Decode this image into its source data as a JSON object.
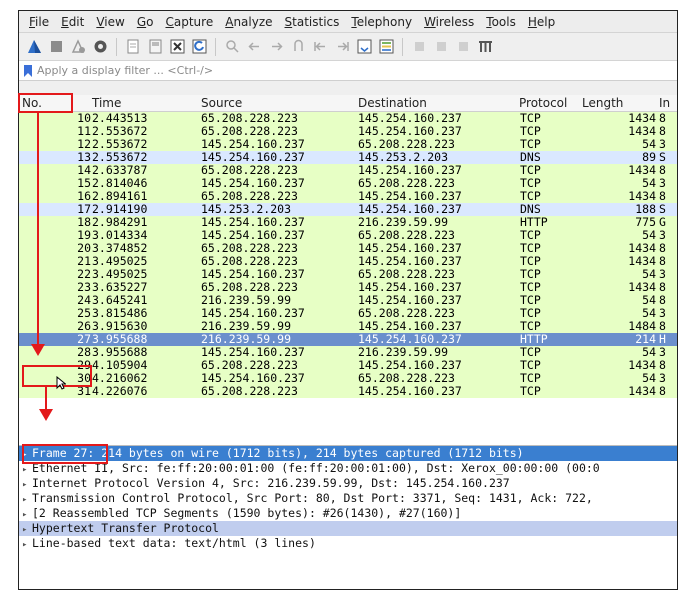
{
  "menu": [
    "File",
    "Edit",
    "View",
    "Go",
    "Capture",
    "Analyze",
    "Statistics",
    "Telephony",
    "Wireless",
    "Tools",
    "Help"
  ],
  "filter": {
    "placeholder": "Apply a display filter ... <Ctrl-/>"
  },
  "columns": {
    "no": "No.",
    "time": "Time",
    "source": "Source",
    "destination": "Destination",
    "protocol": "Protocol",
    "length": "Length",
    "info": "In"
  },
  "colors": {
    "tcp_row": "#e7ffc5",
    "dns_row": "#dae8ff",
    "http_row": "#e4ffc7",
    "selected_row": "#6b8fcc",
    "selected_detail": "#3a7fd0",
    "highlight_detail": "#c0cdee",
    "annotation_red": "#e3191b"
  },
  "packets": [
    {
      "no": "10",
      "time": "2.443513",
      "src": "65.208.228.223",
      "dst": "145.254.160.237",
      "proto": "TCP",
      "len": "1434",
      "info": "8",
      "kind": "tcp"
    },
    {
      "no": "11",
      "time": "2.553672",
      "src": "65.208.228.223",
      "dst": "145.254.160.237",
      "proto": "TCP",
      "len": "1434",
      "info": "8",
      "kind": "tcp"
    },
    {
      "no": "12",
      "time": "2.553672",
      "src": "145.254.160.237",
      "dst": "65.208.228.223",
      "proto": "TCP",
      "len": "54",
      "info": "3",
      "kind": "tcp"
    },
    {
      "no": "13",
      "time": "2.553672",
      "src": "145.254.160.237",
      "dst": "145.253.2.203",
      "proto": "DNS",
      "len": "89",
      "info": "S",
      "kind": "dns"
    },
    {
      "no": "14",
      "time": "2.633787",
      "src": "65.208.228.223",
      "dst": "145.254.160.237",
      "proto": "TCP",
      "len": "1434",
      "info": "8",
      "kind": "tcp"
    },
    {
      "no": "15",
      "time": "2.814046",
      "src": "145.254.160.237",
      "dst": "65.208.228.223",
      "proto": "TCP",
      "len": "54",
      "info": "3",
      "kind": "tcp"
    },
    {
      "no": "16",
      "time": "2.894161",
      "src": "65.208.228.223",
      "dst": "145.254.160.237",
      "proto": "TCP",
      "len": "1434",
      "info": "8",
      "kind": "tcp"
    },
    {
      "no": "17",
      "time": "2.914190",
      "src": "145.253.2.203",
      "dst": "145.254.160.237",
      "proto": "DNS",
      "len": "188",
      "info": "S",
      "kind": "dns"
    },
    {
      "no": "18",
      "time": "2.984291",
      "src": "145.254.160.237",
      "dst": "216.239.59.99",
      "proto": "HTTP",
      "len": "775",
      "info": "G",
      "kind": "tcp"
    },
    {
      "no": "19",
      "time": "3.014334",
      "src": "145.254.160.237",
      "dst": "65.208.228.223",
      "proto": "TCP",
      "len": "54",
      "info": "3",
      "kind": "tcp"
    },
    {
      "no": "20",
      "time": "3.374852",
      "src": "65.208.228.223",
      "dst": "145.254.160.237",
      "proto": "TCP",
      "len": "1434",
      "info": "8",
      "kind": "tcp"
    },
    {
      "no": "21",
      "time": "3.495025",
      "src": "65.208.228.223",
      "dst": "145.254.160.237",
      "proto": "TCP",
      "len": "1434",
      "info": "8",
      "kind": "tcp"
    },
    {
      "no": "22",
      "time": "3.495025",
      "src": "145.254.160.237",
      "dst": "65.208.228.223",
      "proto": "TCP",
      "len": "54",
      "info": "3",
      "kind": "tcp"
    },
    {
      "no": "23",
      "time": "3.635227",
      "src": "65.208.228.223",
      "dst": "145.254.160.237",
      "proto": "TCP",
      "len": "1434",
      "info": "8",
      "kind": "tcp"
    },
    {
      "no": "24",
      "time": "3.645241",
      "src": "216.239.59.99",
      "dst": "145.254.160.237",
      "proto": "TCP",
      "len": "54",
      "info": "8",
      "kind": "tcp"
    },
    {
      "no": "25",
      "time": "3.815486",
      "src": "145.254.160.237",
      "dst": "65.208.228.223",
      "proto": "TCP",
      "len": "54",
      "info": "3",
      "kind": "tcp"
    },
    {
      "no": "26",
      "time": "3.915630",
      "src": "216.239.59.99",
      "dst": "145.254.160.237",
      "proto": "TCP",
      "len": "1484",
      "info": "8",
      "kind": "tcp"
    },
    {
      "no": "27",
      "time": "3.955688",
      "src": "216.239.59.99",
      "dst": "145.254.160.237",
      "proto": "HTTP",
      "len": "214",
      "info": "H",
      "kind": "selected"
    },
    {
      "no": "28",
      "time": "3.955688",
      "src": "145.254.160.237",
      "dst": "216.239.59.99",
      "proto": "TCP",
      "len": "54",
      "info": "3",
      "kind": "tcp"
    },
    {
      "no": "29",
      "time": "4.105904",
      "src": "65.208.228.223",
      "dst": "145.254.160.237",
      "proto": "TCP",
      "len": "1434",
      "info": "8",
      "kind": "tcp"
    },
    {
      "no": "30",
      "time": "4.216062",
      "src": "145.254.160.237",
      "dst": "65.208.228.223",
      "proto": "TCP",
      "len": "54",
      "info": "3",
      "kind": "tcp"
    },
    {
      "no": "31",
      "time": "4.226076",
      "src": "65.208.228.223",
      "dst": "145.254.160.237",
      "proto": "TCP",
      "len": "1434",
      "info": "8",
      "kind": "tcp"
    }
  ],
  "details": [
    {
      "text": "Frame 27: 214 bytes on wire (1712 bits), 214 bytes captured (1712 bits)",
      "kind": "selected"
    },
    {
      "text": "Ethernet II, Src: fe:ff:20:00:01:00 (fe:ff:20:00:01:00), Dst: Xerox_00:00:00 (00:0",
      "kind": "normal"
    },
    {
      "text": "Internet Protocol Version 4, Src: 216.239.59.99, Dst: 145.254.160.237",
      "kind": "normal"
    },
    {
      "text": "Transmission Control Protocol, Src Port: 80, Dst Port: 3371, Seq: 1431, Ack: 722,",
      "kind": "normal"
    },
    {
      "text": "[2 Reassembled TCP Segments (1590 bytes): #26(1430), #27(160)]",
      "kind": "normal"
    },
    {
      "text": "Hypertext Transfer Protocol",
      "kind": "highlight"
    },
    {
      "text": "Line-based text data: text/html (3 lines)",
      "kind": "normal"
    }
  ]
}
